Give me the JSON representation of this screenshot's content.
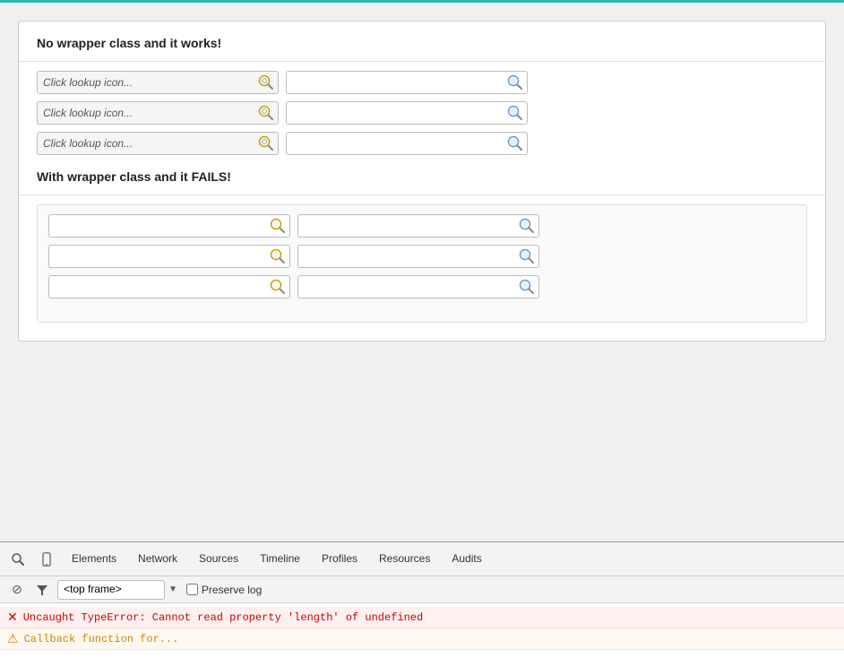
{
  "main": {
    "section1": {
      "title": "No wrapper class and it works!",
      "rows": [
        {
          "left_placeholder": "Click lookup icon...",
          "right_value": ""
        },
        {
          "left_placeholder": "Click lookup icon...",
          "right_value": ""
        },
        {
          "left_placeholder": "Click lookup icon...",
          "right_value": ""
        }
      ]
    },
    "section2": {
      "title": "With wrapper class and it FAILS!",
      "rows": [
        {
          "left_value": "",
          "right_value": ""
        },
        {
          "left_value": "",
          "right_value": ""
        },
        {
          "left_value": "",
          "right_value": ""
        }
      ]
    }
  },
  "devtools": {
    "tabs": [
      {
        "id": "elements",
        "label": "Elements"
      },
      {
        "id": "network",
        "label": "Network"
      },
      {
        "id": "sources",
        "label": "Sources"
      },
      {
        "id": "timeline",
        "label": "Timeline"
      },
      {
        "id": "profiles",
        "label": "Profiles"
      },
      {
        "id": "resources",
        "label": "Resources"
      },
      {
        "id": "audits",
        "label": "Audits"
      }
    ],
    "toolbar": {
      "frame_label": "<top frame>",
      "preserve_log": "Preserve log"
    },
    "console": {
      "error1": "Uncaught TypeError: Cannot read property 'length' of undefined",
      "error2": "Callback function for..."
    }
  }
}
